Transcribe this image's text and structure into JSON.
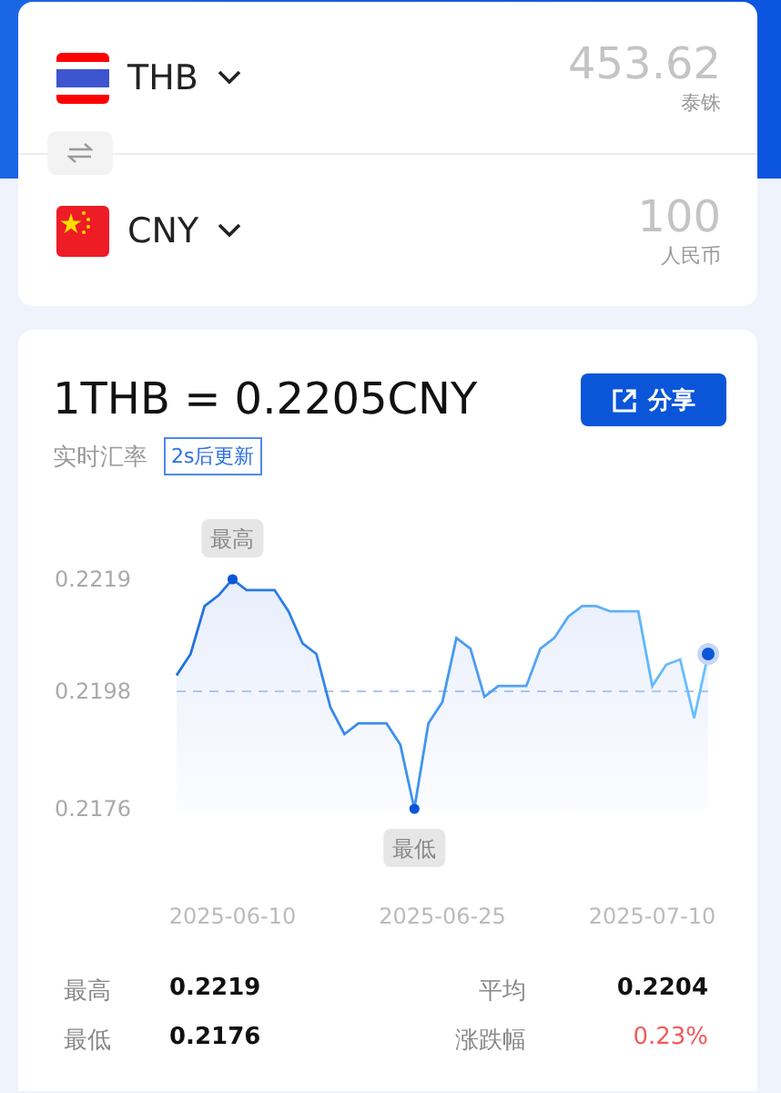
{
  "converter": {
    "rows": [
      {
        "code": "THB",
        "kind": "th",
        "amount": "453.62",
        "currency_name": "泰铢"
      },
      {
        "code": "CNY",
        "kind": "cn",
        "amount": "100",
        "currency_name": "人民币"
      }
    ]
  },
  "rate": {
    "title": "1THB = 0.2205CNY",
    "subtitle": "实时汇率",
    "refresh_badge": "2s后更新",
    "share_button": "分享"
  },
  "chart": {
    "high_label": "最高",
    "low_label": "最低",
    "chart_data": {
      "type": "area",
      "categories": [
        null,
        null,
        null,
        null,
        "2025-06-10",
        null,
        null,
        null,
        null,
        null,
        null,
        null,
        null,
        null,
        null,
        null,
        null,
        null,
        null,
        "2025-06-25",
        null,
        null,
        null,
        null,
        null,
        null,
        null,
        null,
        null,
        null,
        null,
        null,
        null,
        null,
        "2025-07-10",
        null,
        null,
        null,
        null
      ],
      "series": [
        {
          "color": "#1e6fe0",
          "values": [
            0.2201,
            0.2205,
            0.2214,
            0.2216,
            0.2219,
            0.2217,
            0.2217,
            0.2217,
            0.2213,
            0.2207,
            0.2205,
            0.2195,
            0.219,
            0.2192,
            0.2192,
            0.2192,
            0.2188,
            0.2176,
            0.2192,
            0.2196,
            0.2208,
            0.2206,
            0.2197,
            0.2199,
            0.2199,
            0.2199,
            0.2206,
            0.2208,
            0.2212,
            0.2214,
            0.2214,
            0.2213,
            0.2213,
            0.2213,
            0.2199,
            0.2203,
            0.2204,
            0.2193,
            0.2205
          ]
        }
      ],
      "ylim": [
        0.2176,
        0.2219
      ],
      "yticks": [
        0.2219,
        0.2198,
        0.2176
      ],
      "ref_lines": [
        {
          "axis": "y",
          "value": 0.2198
        }
      ]
    }
  },
  "stats": [
    {
      "label": "最高",
      "value": "0.2219",
      "kind": "plain"
    },
    {
      "label": "平均",
      "value": "0.2204",
      "kind": "plain"
    },
    {
      "label": "最低",
      "value": "0.2176",
      "kind": "plain"
    },
    {
      "label": "涨跌幅",
      "value": "0.23%",
      "kind": "up"
    }
  ]
}
